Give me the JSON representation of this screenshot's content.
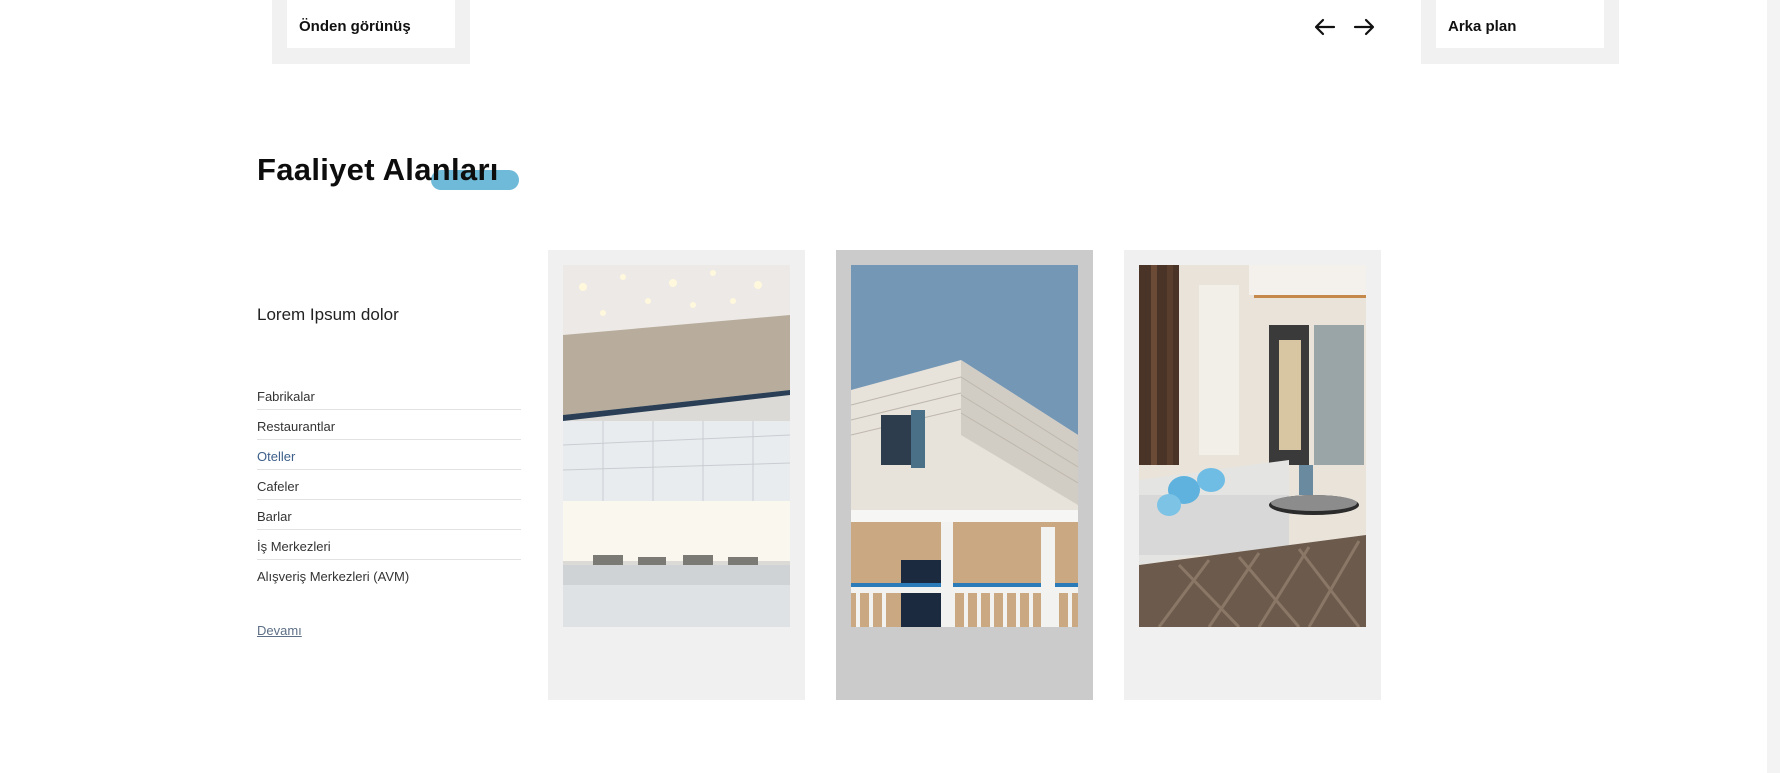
{
  "carousel": {
    "left_tile_label": "Önden görünüş",
    "right_tile_label": "Arka plan",
    "prev_icon": "arrow-left-icon",
    "next_icon": "arrow-right-icon"
  },
  "section": {
    "title": "Faaliyet Alanları",
    "accent_color": "#6fbad8",
    "intro": "Lorem Ipsum dolor"
  },
  "categories": [
    {
      "label": "Fabrikalar",
      "active": false
    },
    {
      "label": "Restaurantlar",
      "active": false
    },
    {
      "label": "Oteller",
      "active": true
    },
    {
      "label": "Cafeler",
      "active": false
    },
    {
      "label": "Barlar",
      "active": false
    },
    {
      "label": "İş Merkezleri",
      "active": false
    },
    {
      "label": "Alışveriş Merkezleri (AVM)",
      "active": false
    }
  ],
  "more_link": "Devamı",
  "cards": [
    {
      "image": "hotel-lobby-photo",
      "selected": false
    },
    {
      "image": "building-exterior-photo",
      "selected": true
    },
    {
      "image": "living-room-photo",
      "selected": false
    }
  ]
}
